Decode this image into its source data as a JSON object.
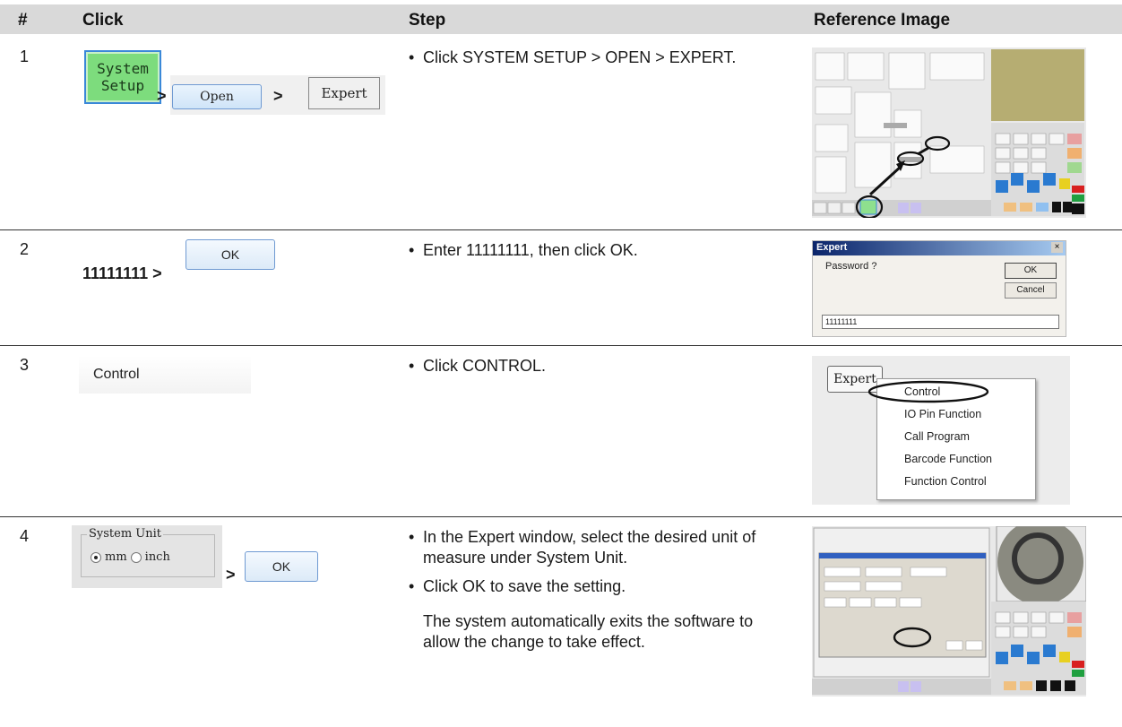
{
  "headers": {
    "num": "#",
    "click": "Click",
    "step": "Step",
    "ref": "Reference Image"
  },
  "rows": [
    {
      "num": "1",
      "click": {
        "system_setup": "System Setup",
        "sep1": ">",
        "open": "Open",
        "sep2": ">",
        "expert": "Expert"
      },
      "step": [
        "Click SYSTEM SETUP > OPEN > EXPERT."
      ]
    },
    {
      "num": "2",
      "click": {
        "password": "11111111 >",
        "ok": "OK"
      },
      "step": [
        "Enter 11111111, then click OK."
      ],
      "ref": {
        "title": "Expert",
        "prompt": "Password ?",
        "ok": "OK",
        "cancel": "Cancel",
        "value": "11111111",
        "close": "×"
      }
    },
    {
      "num": "3",
      "click": {
        "control": "Control"
      },
      "step": [
        "Click CONTROL."
      ],
      "ref": {
        "button": "Expert",
        "menu": [
          "Control",
          "IO Pin Function",
          "Call Program",
          "Barcode Function",
          "Function Control"
        ]
      }
    },
    {
      "num": "4",
      "click": {
        "group": "System Unit",
        "mm": "mm",
        "inch": "inch",
        "sep": ">",
        "ok": "OK"
      },
      "step": [
        "In the Expert window, select the desired unit of measure under System Unit.",
        "Click OK to save the setting."
      ],
      "note": "The system automatically exits the software to allow the change to take effect."
    }
  ],
  "colors": {
    "header_bg": "#d9d9d9",
    "system_btn": "#7ddc7d",
    "accent": "#3a88d8"
  }
}
